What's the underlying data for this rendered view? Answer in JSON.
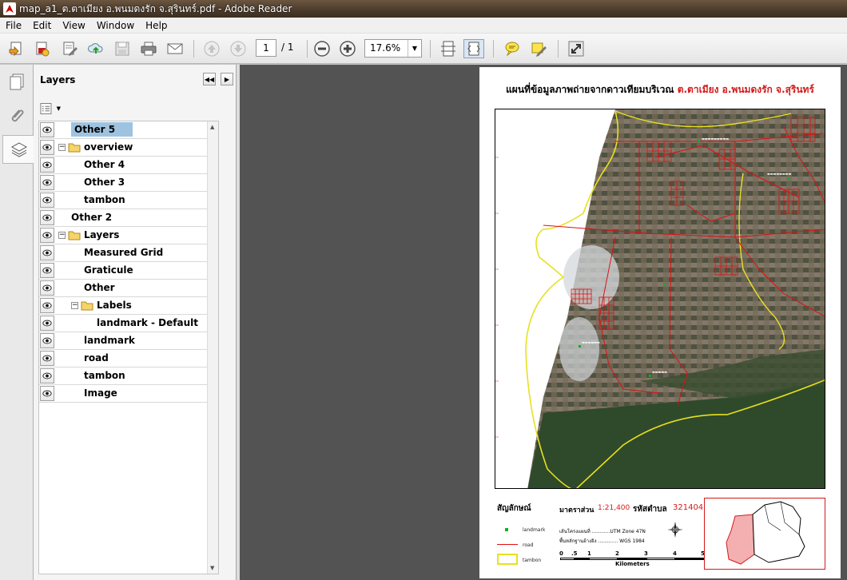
{
  "window": {
    "title": "map_a1_ต.ตาเมียง อ.พนมดงรัก จ.สุรินทร์.pdf - Adobe Reader"
  },
  "menu": [
    "File",
    "Edit",
    "View",
    "Window",
    "Help"
  ],
  "toolbar": {
    "page_current": "1",
    "page_total": "/ 1",
    "zoom": "17.6%"
  },
  "layers_panel": {
    "title": "Layers",
    "items": [
      {
        "label": "Other 5",
        "level": 0,
        "selected": true
      },
      {
        "label": "overview",
        "level": 0,
        "group": true
      },
      {
        "label": "Other 4",
        "level": 1
      },
      {
        "label": "Other 3",
        "level": 1
      },
      {
        "label": "tambon",
        "level": 1
      },
      {
        "label": "Other 2",
        "level": 0
      },
      {
        "label": "Layers",
        "level": 0,
        "group": true
      },
      {
        "label": "Measured Grid",
        "level": 1
      },
      {
        "label": "Graticule",
        "level": 1
      },
      {
        "label": "Other",
        "level": 1
      },
      {
        "label": "Labels",
        "level": 1,
        "group": true
      },
      {
        "label": "landmark - Default",
        "level": 2
      },
      {
        "label": "landmark",
        "level": 1
      },
      {
        "label": "road",
        "level": 1
      },
      {
        "label": "tambon",
        "level": 1
      },
      {
        "label": "Image",
        "level": 1
      }
    ]
  },
  "map": {
    "title_black": "แผนที่ข้อมูลภาพถ่ายจากดาวเทียมบริเวณ",
    "title_red": "ต.ตาเมียง อ.พนมดงรัก จ.สุรินทร์",
    "legend_title": "สัญลักษณ์",
    "legend_items": [
      "landmark",
      "road",
      "tambon"
    ],
    "scale_label": "มาตราส่วน",
    "scale_value": "1:21,400",
    "tambon_code_label": "รหัสตำบล",
    "tambon_code": "321404",
    "projection_line": "เส้นโครงแผนที่ ............UTM Zone 47N",
    "datum_line": "พื้นหลักฐานอ้างอิง ............. WGS 1984",
    "scalebar_ticks": [
      "0",
      ".5",
      "1",
      "2",
      "3",
      "4",
      "5"
    ],
    "scalebar_unit": "Kilometers"
  },
  "colors": {
    "road": "#e01010",
    "tambon": "#e8e020",
    "landmark": "#10b020",
    "title_red": "#d41a1a",
    "inset_fill": "#f4b0b0"
  }
}
